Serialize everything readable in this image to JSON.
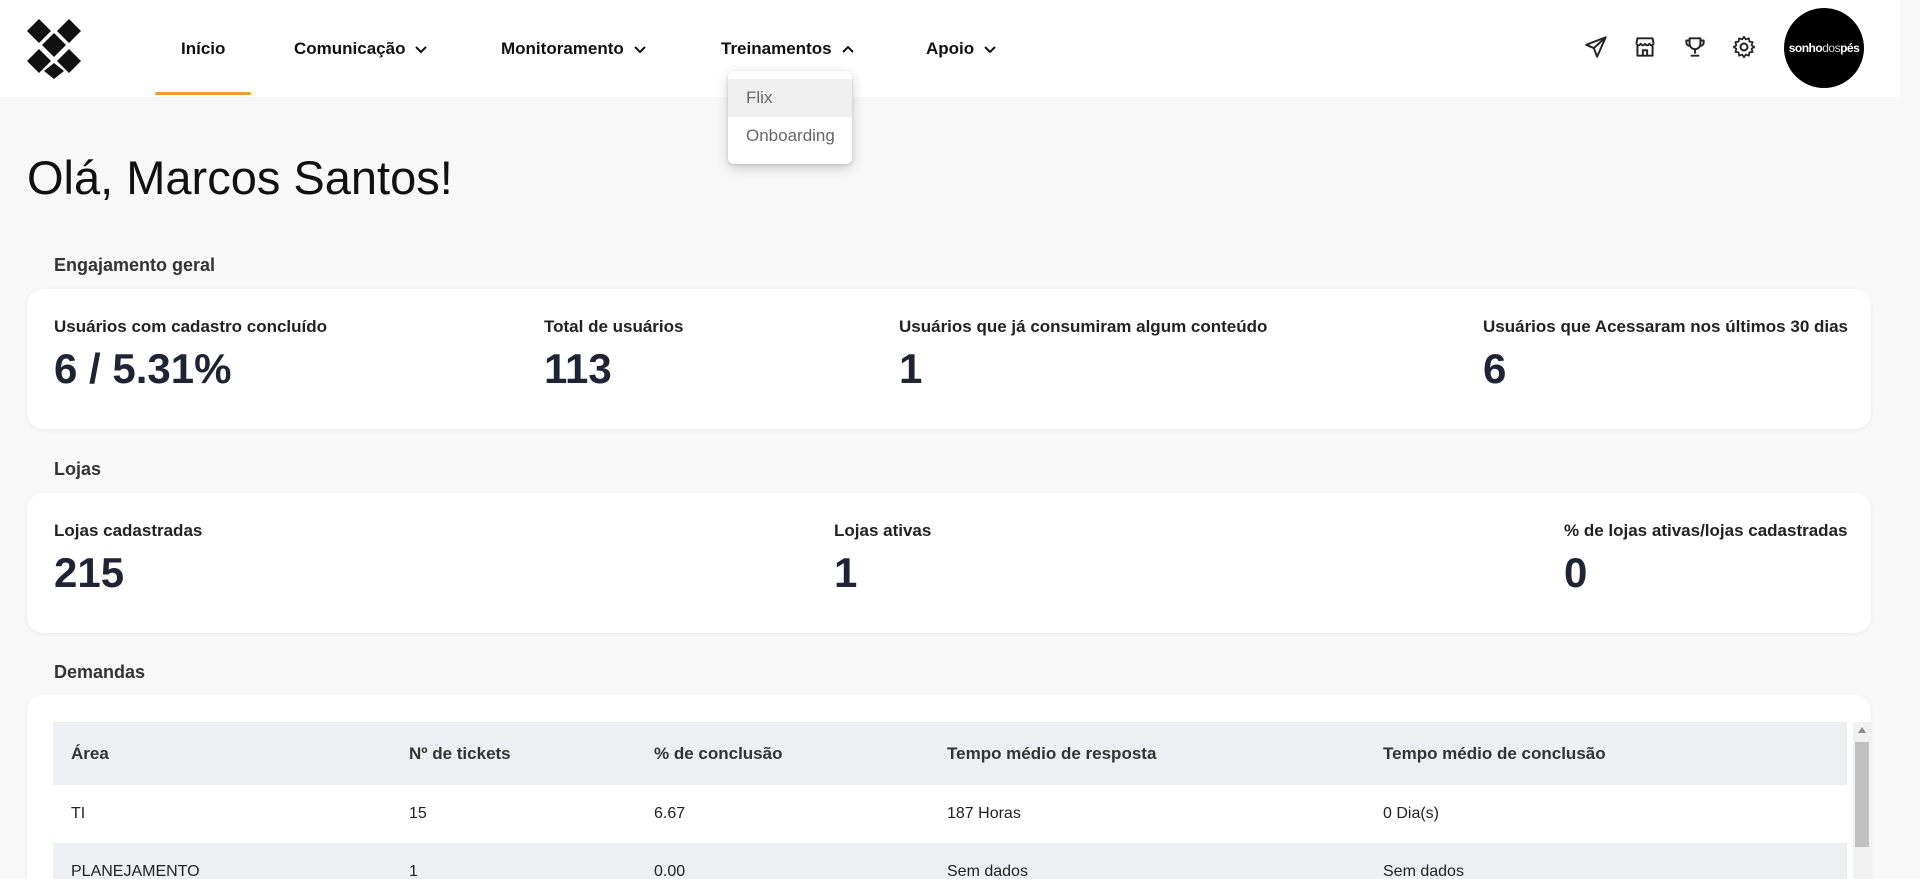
{
  "nav": {
    "items": [
      {
        "label": "Início"
      },
      {
        "label": "Comunicação"
      },
      {
        "label": "Monitoramento"
      },
      {
        "label": "Treinamentos"
      },
      {
        "label": "Apoio"
      }
    ],
    "dropdown": {
      "items": [
        {
          "label": "Flix"
        },
        {
          "label": "Onboarding"
        }
      ]
    }
  },
  "icons": [
    "send-icon",
    "store-icon",
    "trophy-icon",
    "gear-icon"
  ],
  "avatar": {
    "brand_part1": "sonho",
    "brand_part2": "dos",
    "brand_part3": "pés"
  },
  "greeting": "Olá, Marcos Santos!",
  "engajamento": {
    "title": "Engajamento geral",
    "metrics": [
      {
        "label": "Usuários com cadastro concluído",
        "value": "6 / 5.31%"
      },
      {
        "label": "Total de usuários",
        "value": "113"
      },
      {
        "label": "Usuários que já consumiram algum conteúdo",
        "value": "1"
      },
      {
        "label": "Usuários que Acessaram nos últimos 30 dias",
        "value": "6"
      }
    ]
  },
  "lojas": {
    "title": "Lojas",
    "metrics": [
      {
        "label": "Lojas cadastradas",
        "value": "215"
      },
      {
        "label": "Lojas ativas",
        "value": "1"
      },
      {
        "label": "% de lojas ativas/lojas cadastradas",
        "value": "0"
      }
    ]
  },
  "demandas": {
    "title": "Demandas",
    "columns": [
      "Área",
      "Nº de tickets",
      "% de conclusão",
      "Tempo médio de resposta",
      "Tempo médio de conclusão"
    ],
    "rows": [
      [
        "TI",
        "15",
        "6.67",
        "187 Horas",
        "0 Dia(s)"
      ],
      [
        "PLANEJAMENTO",
        "1",
        "0.00",
        "Sem dados",
        "Sem dados"
      ]
    ]
  },
  "colors": {
    "accent": "#f29a3a",
    "value_text": "#1e2433",
    "table_header_bg": "#edeff2"
  }
}
